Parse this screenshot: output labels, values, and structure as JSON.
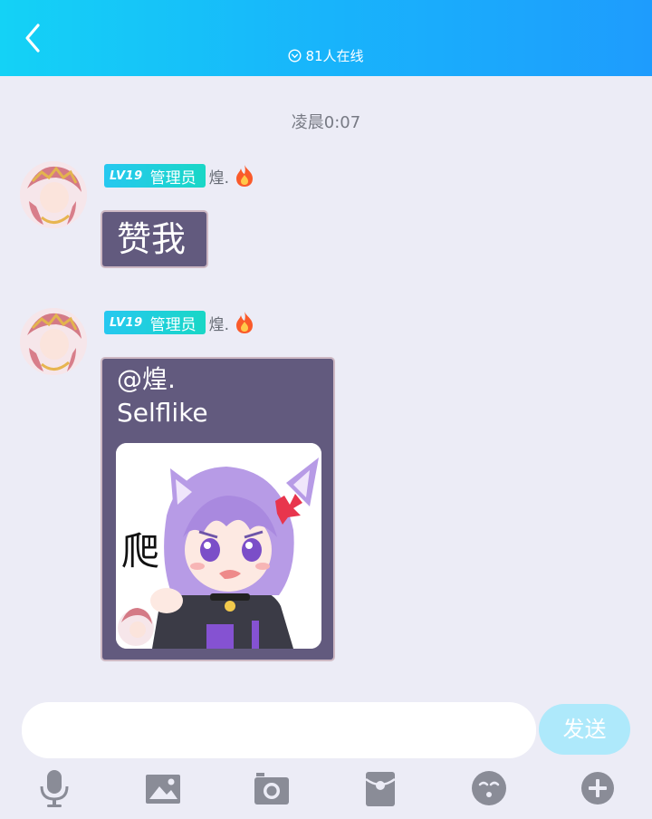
{
  "header": {
    "online_text": "81人在线"
  },
  "chat": {
    "timestamp": "凌晨0:07",
    "messages": [
      {
        "level": "LV19",
        "role": "管理员",
        "username": "煌.",
        "text": "赞我"
      },
      {
        "level": "LV19",
        "role": "管理员",
        "username": "煌.",
        "mention": "@煌.",
        "text": "Selflike",
        "sticker_text": "爬"
      }
    ]
  },
  "composer": {
    "placeholder": "",
    "send_label": "发送"
  },
  "toolbar": {
    "icons": [
      "microphone-icon",
      "image-icon",
      "camera-icon",
      "red-packet-icon",
      "emoji-icon",
      "plus-icon"
    ]
  },
  "colors": {
    "header_start": "#14d2f6",
    "header_end": "#1e9cfd",
    "bubble": "#625a7e",
    "send_button": "#aee9fb",
    "toolbar_icon": "#8a8c97"
  }
}
